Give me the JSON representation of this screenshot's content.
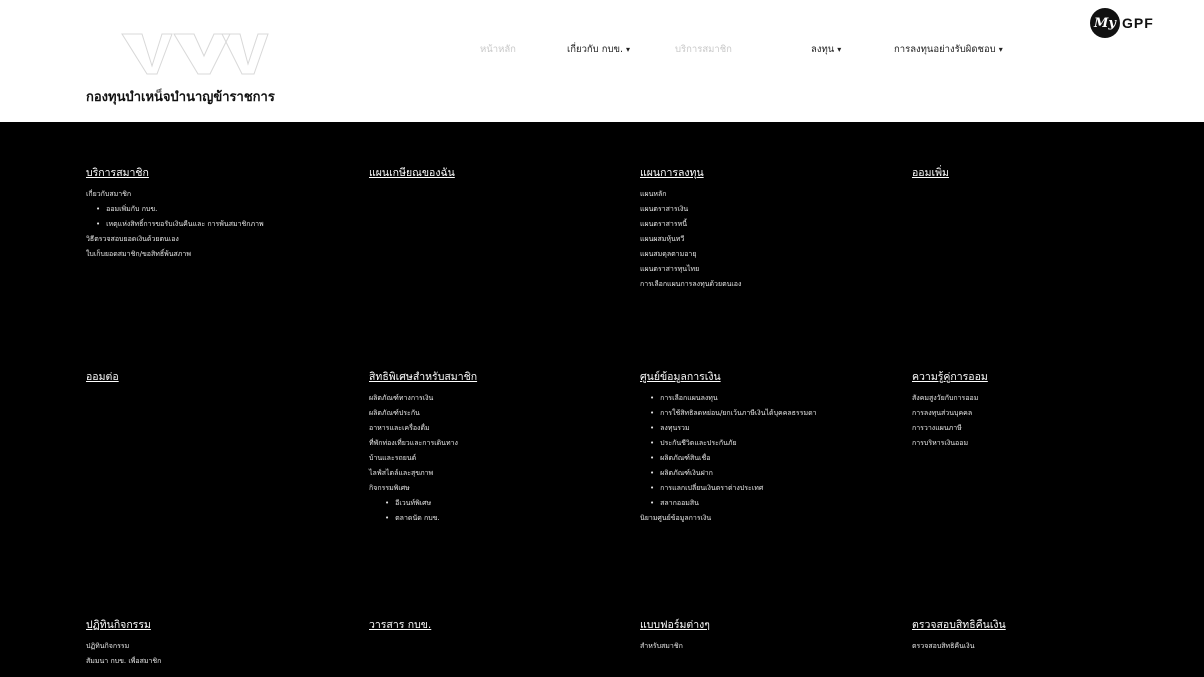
{
  "header": {
    "org_name": "กองทุนบำเหน็จบำนาญข้าราชการ",
    "nav": [
      {
        "label": "หน้าหลัก",
        "faded": true,
        "caret": ""
      },
      {
        "label": "เกี่ยวกับ กบข.",
        "faded": false,
        "caret": "▾"
      },
      {
        "label": "บริการสมาชิก",
        "faded": true,
        "caret": ""
      },
      {
        "label": "ลงทุน",
        "faded": false,
        "caret": "▾"
      },
      {
        "label": "การลงทุนอย่างรับผิดชอบ",
        "faded": false,
        "caret": "▾"
      }
    ],
    "mygpf": {
      "badge": "My",
      "text": "GPF"
    }
  },
  "mega": {
    "row1": [
      {
        "title": "บริการสมาชิก",
        "items": [
          {
            "label": "เกี่ยวกับสมาชิก",
            "level": 0
          },
          {
            "label": "ออมเพิ่มกับ กบข.",
            "level": 1
          },
          {
            "label": "เหตุแห่งสิทธิ์การขอรับเงินคืนและ การพ้นสมาชิกภาพ",
            "level": 1
          },
          {
            "label": "วิธีตรวจสอบยอดเงินด้วยตนเอง",
            "level": 0
          },
          {
            "label": "ใบเก็บยอดสมาชิก/ขอสิทธิ์พ้นสภาพ",
            "level": 0
          }
        ]
      },
      {
        "title": "แผนเกษียณของฉัน",
        "items": []
      },
      {
        "title": "แผนการลงทุน",
        "items": [
          {
            "label": "แผนหลัก",
            "level": 0
          },
          {
            "label": "แผนตราสารเงิน",
            "level": 0
          },
          {
            "label": "แผนตราสารหนี้",
            "level": 0
          },
          {
            "label": "แผนผสมหุ้นทวี",
            "level": 0
          },
          {
            "label": "แผนสมดุลตามอายุ",
            "level": 0
          },
          {
            "label": "แผนตราสารทุนไทย",
            "level": 0
          },
          {
            "label": "การเลือกแผนการลงทุนด้วยตนเอง",
            "level": 0
          }
        ]
      },
      {
        "title": "ออมเพิ่ม",
        "items": []
      }
    ],
    "row2": [
      {
        "title": "ออมต่อ",
        "items": []
      },
      {
        "title": "สิทธิพิเศษสำหรับสมาชิก",
        "items": [
          {
            "label": "ผลิตภัณฑ์ทางการเงิน",
            "level": 0
          },
          {
            "label": "ผลิตภัณฑ์ประกัน",
            "level": 0
          },
          {
            "label": "อาหารและเครื่องดื่ม",
            "level": 0
          },
          {
            "label": "ที่พักท่องเที่ยวและการเดินทาง",
            "level": 0
          },
          {
            "label": "บ้านและรถยนต์",
            "level": 0
          },
          {
            "label": "ไลฟ์สไตล์และสุขภาพ",
            "level": 0
          },
          {
            "label": "กิจกรรมพิเศษ",
            "level": 0
          },
          {
            "label": "อีเวนท์พิเศษ",
            "level": 2
          },
          {
            "label": "ตลาดนัด กบข.",
            "level": 2
          }
        ]
      },
      {
        "title": "ศูนย์ข้อมูลการเงิน",
        "items": [
          {
            "label": "การเลือกแผนลงทุน",
            "level": 1
          },
          {
            "label": "การใช้สิทธิลดหย่อน/ยกเว้นภาษีเงินได้บุคคลธรรมดา",
            "level": 1
          },
          {
            "label": "ลงทุนรวม",
            "level": 1
          },
          {
            "label": "ประกันชีวิตและประกันภัย",
            "level": 1
          },
          {
            "label": "ผลิตภัณฑ์สินเชื่อ",
            "level": 1
          },
          {
            "label": "ผลิตภัณฑ์เงินฝาก",
            "level": 1
          },
          {
            "label": "การแลกเปลี่ยนเงินตราต่างประเทศ",
            "level": 1
          },
          {
            "label": "สลากออมสิน",
            "level": 1
          },
          {
            "label": "นิยามศูนย์ข้อมูลการเงิน",
            "level": 0
          }
        ]
      },
      {
        "title": "ความรู้คู่การออม",
        "items": [
          {
            "label": "สังคมสูงวัยกับการออม",
            "level": 0
          },
          {
            "label": "การลงทุนส่วนบุคคล",
            "level": 0
          },
          {
            "label": "การวางแผนภาษี",
            "level": 0
          },
          {
            "label": "การบริหารเงินออม",
            "level": 0
          }
        ]
      }
    ],
    "row3": [
      {
        "title": "ปฏิทินกิจกรรม",
        "items": [
          {
            "label": "ปฏิทินกิจกรรม",
            "level": 0
          },
          {
            "label": "สัมมนา กบข. เพื่อสมาชิก",
            "level": 0
          }
        ]
      },
      {
        "title": "วารสาร กบข.",
        "items": []
      },
      {
        "title": "แบบฟอร์มต่างๆ",
        "items": [
          {
            "label": "สำหรับสมาชิก",
            "level": 0
          }
        ]
      },
      {
        "title": "ตรวจสอบสิทธิคืนเงิน",
        "items": [
          {
            "label": "ตรวจสอบสิทธิคืนเงิน",
            "level": 0
          }
        ]
      }
    ]
  }
}
